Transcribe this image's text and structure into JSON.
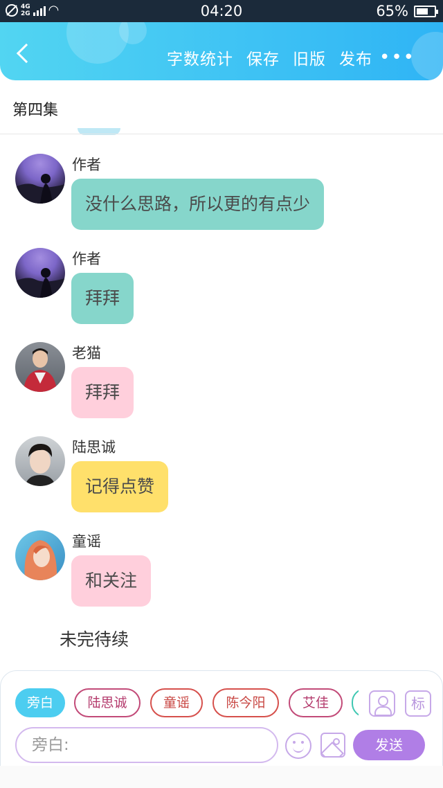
{
  "status_bar": {
    "network_top": "4G",
    "network_bottom": "2G",
    "time": "04:20",
    "battery_percent": "65%",
    "battery_level": 0.65
  },
  "header": {
    "back_icon": "chevron-left-icon",
    "actions": [
      "字数统计",
      "保存",
      "旧版",
      "发布"
    ],
    "more_icon": "more-dots-icon",
    "more_label": "•••",
    "gradient": [
      "#52d5f2",
      "#2fb4f5"
    ]
  },
  "episode_title": "第四集",
  "messages": [
    {
      "speaker": "作者",
      "text": "没什么思路，所以更的有点少",
      "bubble_color": "#86d6cb"
    },
    {
      "speaker": "作者",
      "text": "拜拜",
      "bubble_color": "#86d6cb"
    },
    {
      "speaker": "老猫",
      "text": "拜拜",
      "bubble_color": "#ffcfdc"
    },
    {
      "speaker": "陆思诚",
      "text": "记得点赞",
      "bubble_color": "#ffe06b"
    },
    {
      "speaker": "童谣",
      "text": "和关注",
      "bubble_color": "#ffcfdc"
    }
  ],
  "narration": "未完待续",
  "composer": {
    "roles": [
      "旁白",
      "陆思诚",
      "童谣",
      "陈今阳",
      "艾佳"
    ],
    "selected_role": "旁白",
    "role_icon": "add-role-icon",
    "tag_label": "标",
    "input_placeholder": "旁白:",
    "input_value": "",
    "emoji_icon": "emoji-icon",
    "image_icon": "image-icon",
    "send_label": "发送"
  }
}
